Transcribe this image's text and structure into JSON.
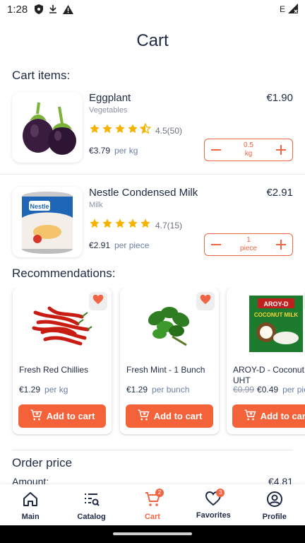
{
  "status_bar": {
    "time": "1:28",
    "network": "E"
  },
  "page": {
    "title": "Cart"
  },
  "cart": {
    "section_title": "Cart items:",
    "items": [
      {
        "name": "Eggplant",
        "category": "Vegetables",
        "price": "€1.90",
        "rating": "4.5(50)",
        "rating_value": 4.5,
        "unit_price": "€3.79",
        "unit": "per kg",
        "qty_value": "0.5",
        "qty_unit": "kg"
      },
      {
        "name": "Nestle Condensed Milk",
        "category": "Milk",
        "price": "€2.91",
        "rating": "4.7(15)",
        "rating_value": 4.7,
        "unit_price": "€2.91",
        "unit": "per piece",
        "qty_value": "1",
        "qty_unit": "piece"
      }
    ]
  },
  "recommendations": {
    "section_title": "Recommendations:",
    "items": [
      {
        "name": "Fresh Red Chillies",
        "price": "€1.29",
        "unit": "per kg",
        "old_price": "",
        "button": "Add to cart"
      },
      {
        "name": "Fresh Mint - 1 Bunch",
        "price": "€1.29",
        "unit": "per bunch",
        "old_price": "",
        "button": "Add to cart"
      },
      {
        "name": "AROY-D - Coconut Milk UHT",
        "price": "€0.49",
        "unit": "per piece",
        "old_price": "€0.99",
        "button": "Add to cart",
        "image_text": "AROY-D",
        "image_sub": "COCONUT MILK"
      }
    ]
  },
  "order": {
    "title": "Order price",
    "amount_label": "Amount:",
    "amount_value": "€4.81"
  },
  "nav": {
    "items": [
      {
        "label": "Main",
        "icon": "home-icon"
      },
      {
        "label": "Catalog",
        "icon": "catalog-icon"
      },
      {
        "label": "Cart",
        "icon": "cart-icon",
        "badge": "2"
      },
      {
        "label": "Favorites",
        "icon": "heart-icon",
        "badge": "3"
      },
      {
        "label": "Profile",
        "icon": "profile-icon"
      }
    ]
  },
  "colors": {
    "accent": "#f06543",
    "text": "#1e2a44",
    "star": "#f5b301"
  }
}
